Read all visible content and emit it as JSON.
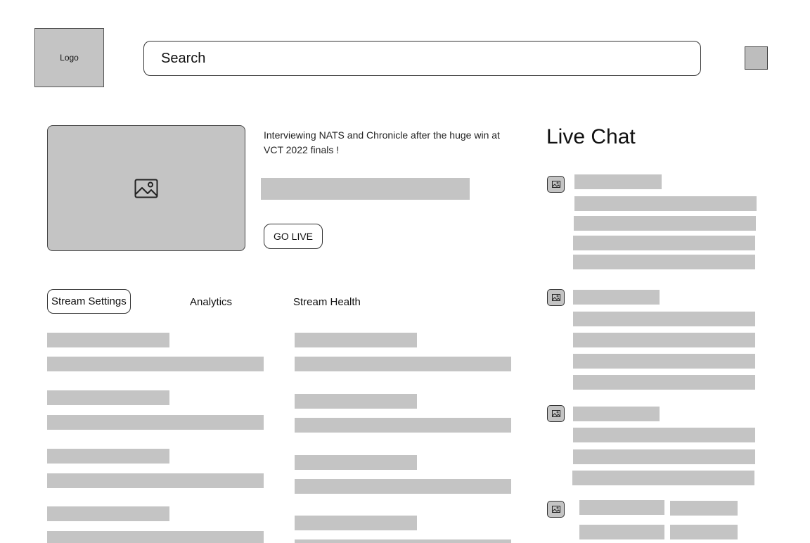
{
  "header": {
    "logo_label": "Logo",
    "search_value": "Search"
  },
  "stream": {
    "description": "Interviewing NATS and Chronicle after the huge win at VCT 2022 finals !",
    "go_live_label": "GO LIVE"
  },
  "tabs": [
    {
      "label": "Stream Settings",
      "active": true
    },
    {
      "label": "Analytics",
      "active": false
    },
    {
      "label": "Stream Health",
      "active": false
    }
  ],
  "chat": {
    "title": "Live Chat"
  },
  "colors": {
    "placeholder_gray": "#c4c4c4",
    "border": "#333333"
  }
}
